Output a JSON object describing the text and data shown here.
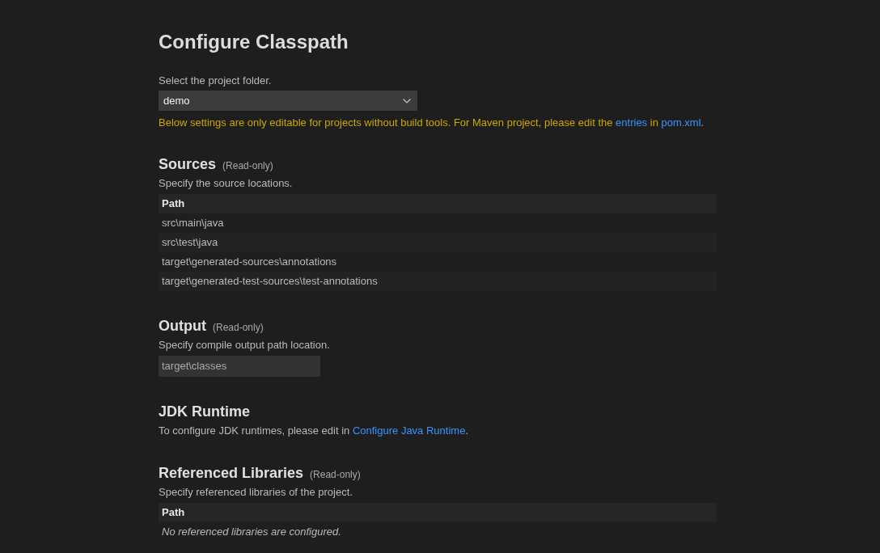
{
  "page": {
    "title": "Configure Classpath"
  },
  "project": {
    "label": "Select the project folder.",
    "value": "demo",
    "notice": [
      {
        "kind": "text",
        "text": "Below settings are only editable for projects without build tools. For Maven project, please edit the "
      },
      {
        "kind": "link",
        "text": "entries"
      },
      {
        "kind": "text",
        "text": " in "
      },
      {
        "kind": "link",
        "text": "pom.xml"
      },
      {
        "kind": "text",
        "text": "."
      }
    ]
  },
  "sections": [
    {
      "kind": "table",
      "title": "Sources",
      "tag": "(Read-only)",
      "description": "Specify the source locations.",
      "columns": [
        "Path"
      ],
      "rows": [
        "src\\main\\java",
        "src\\test\\java",
        "target\\generated-sources\\annotations",
        "target\\generated-test-sources\\test-annotations"
      ]
    },
    {
      "kind": "field",
      "title": "Output",
      "tag": "(Read-only)",
      "description": "Specify compile output path location.",
      "value": "target\\classes"
    },
    {
      "kind": "text",
      "title": "JDK Runtime",
      "description": [
        {
          "kind": "text",
          "text": "To configure JDK runtimes, please edit in "
        },
        {
          "kind": "link",
          "text": "Configure Java Runtime"
        },
        {
          "kind": "text",
          "text": "."
        }
      ]
    },
    {
      "kind": "table",
      "title": "Referenced Libraries",
      "tag": "(Read-only)",
      "description": "Specify referenced libraries of the project.",
      "columns": [
        "Path"
      ],
      "empty_message": "No referenced libraries are configured."
    }
  ]
}
